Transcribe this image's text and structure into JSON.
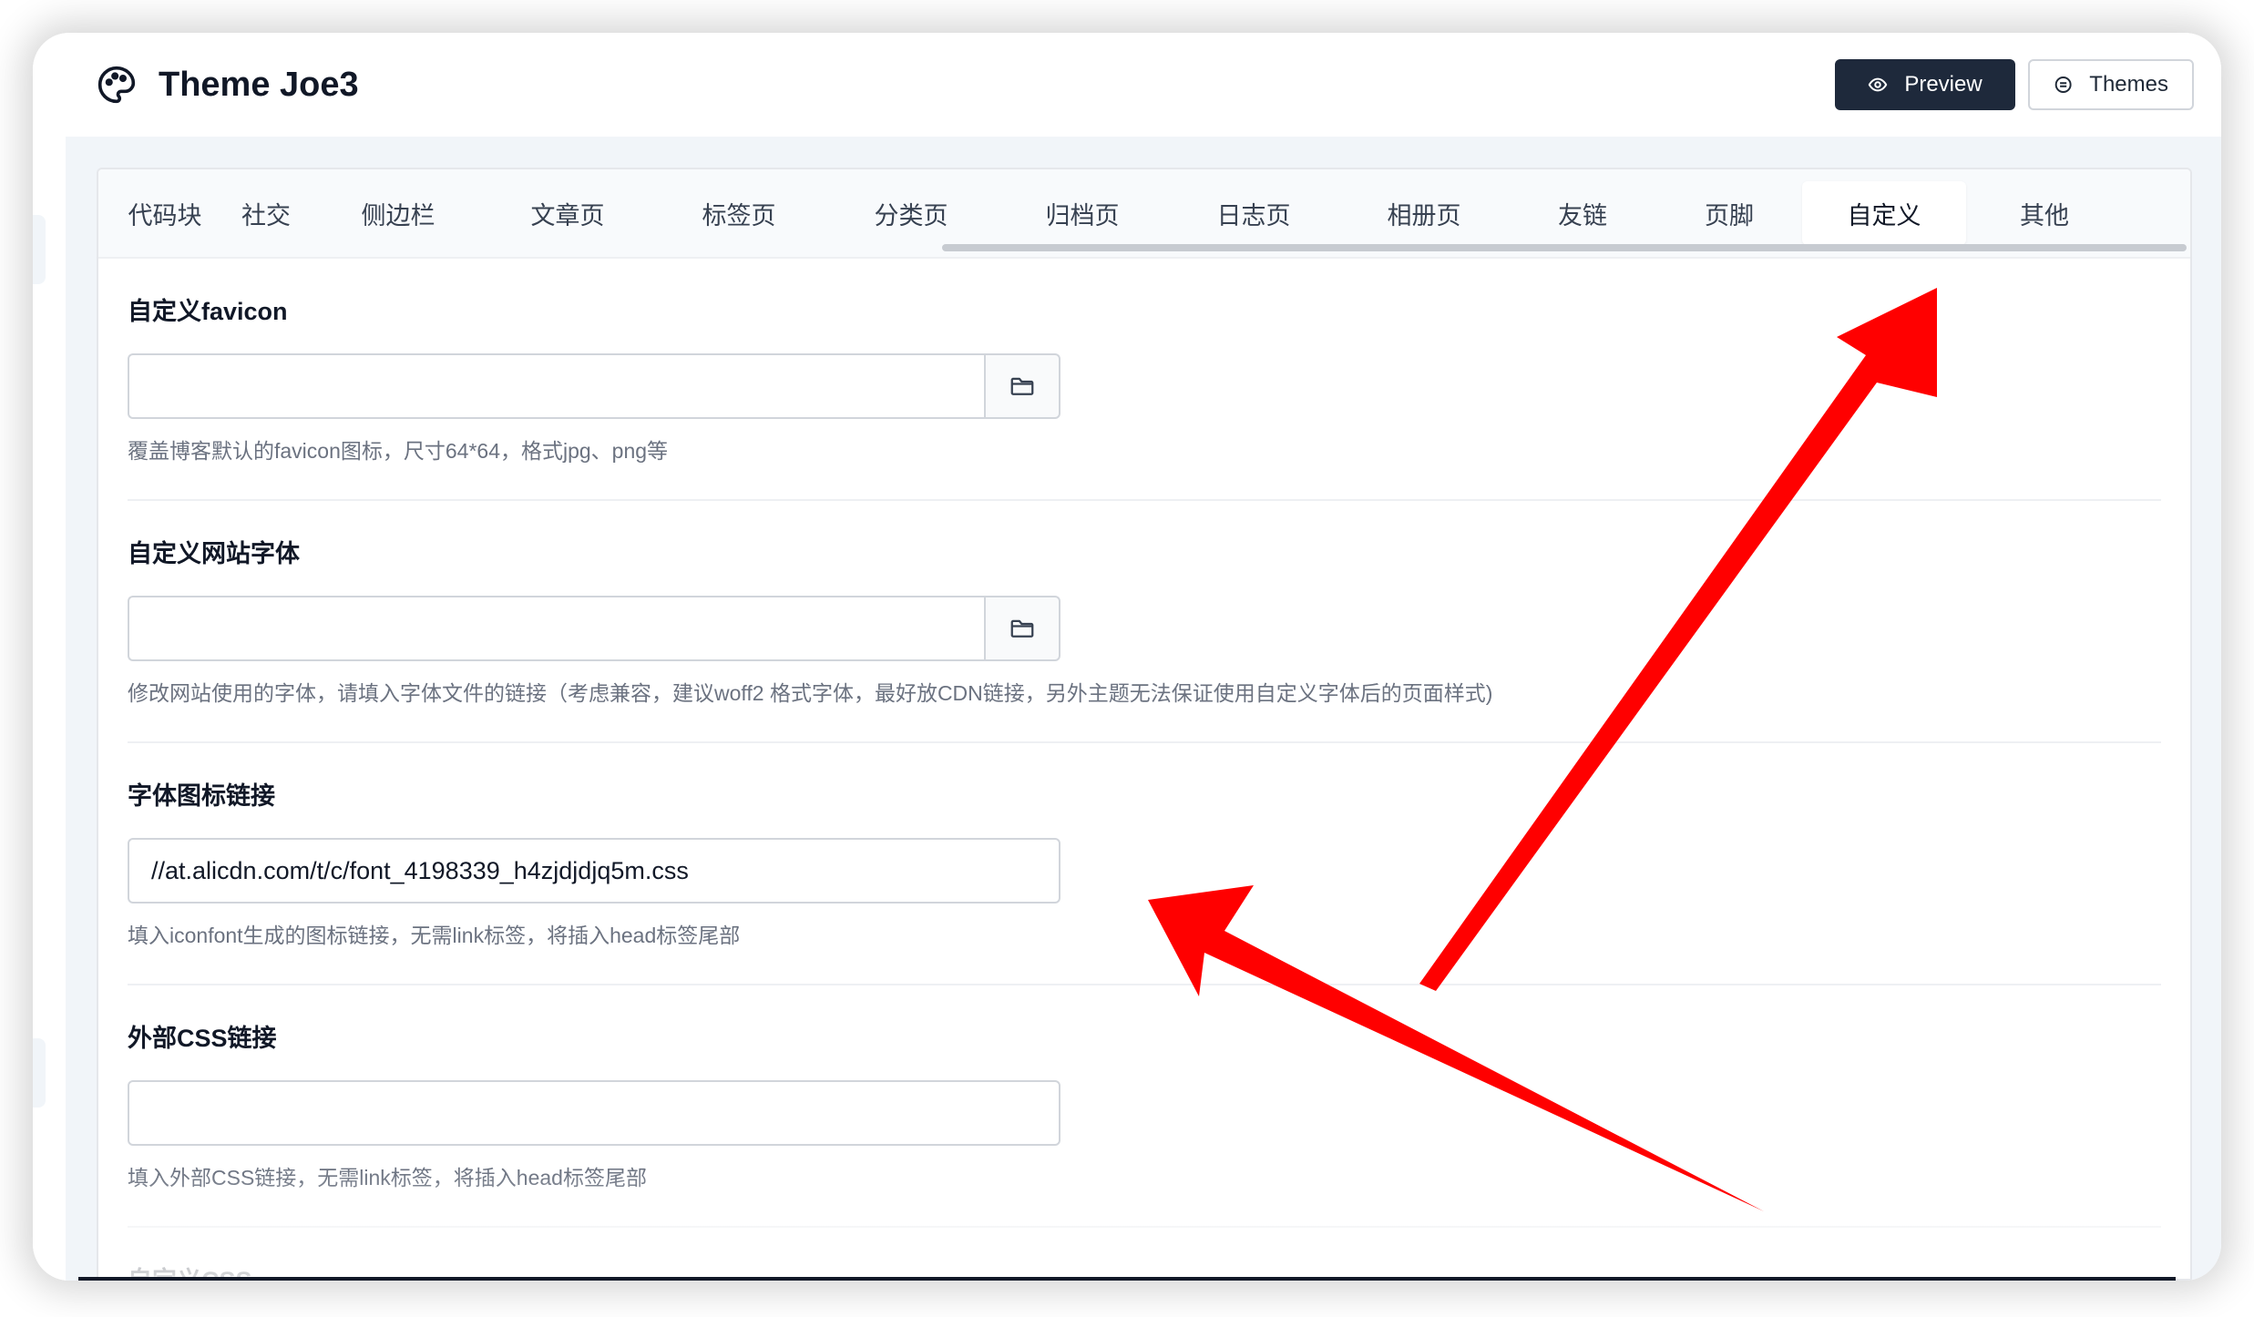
{
  "header": {
    "title": "Theme Joe3",
    "preview_label": "Preview",
    "themes_label": "Themes"
  },
  "tabs": [
    {
      "label": "代码块"
    },
    {
      "label": "社交"
    },
    {
      "label": "侧边栏"
    },
    {
      "label": "文章页"
    },
    {
      "label": "标签页"
    },
    {
      "label": "分类页"
    },
    {
      "label": "归档页"
    },
    {
      "label": "日志页"
    },
    {
      "label": "相册页"
    },
    {
      "label": "友链"
    },
    {
      "label": "页脚"
    },
    {
      "label": "自定义",
      "active": true
    },
    {
      "label": "其他"
    }
  ],
  "fields": [
    {
      "label": "自定义favicon",
      "value": "",
      "has_picker": true,
      "help": "覆盖博客默认的favicon图标，尺寸64*64，格式jpg、png等"
    },
    {
      "label": "自定义网站字体",
      "value": "",
      "has_picker": true,
      "help": "修改网站使用的字体，请填入字体文件的链接（考虑兼容，建议woff2 格式字体，最好放CDN链接，另外主题无法保证使用自定义字体后的页面样式)"
    },
    {
      "label": "字体图标链接",
      "value": "//at.alicdn.com/t/c/font_4198339_h4zjdjdjq5m.css",
      "has_picker": false,
      "help": "填入iconfont生成的图标链接，无需link标签，将插入head标签尾部"
    },
    {
      "label": "外部CSS链接",
      "value": "",
      "has_picker": false,
      "help": "填入外部CSS链接，无需link标签，将插入head标签尾部"
    },
    {
      "label": "自定义CSS"
    }
  ],
  "icons": {
    "app": "palette-icon",
    "preview": "eye-icon",
    "themes": "swatch-icon",
    "picker": "folder-icon"
  },
  "colors": {
    "primary_button": "#1e293b",
    "annotation_arrow": "#ff0000",
    "page_background": "#f1f5f9"
  }
}
